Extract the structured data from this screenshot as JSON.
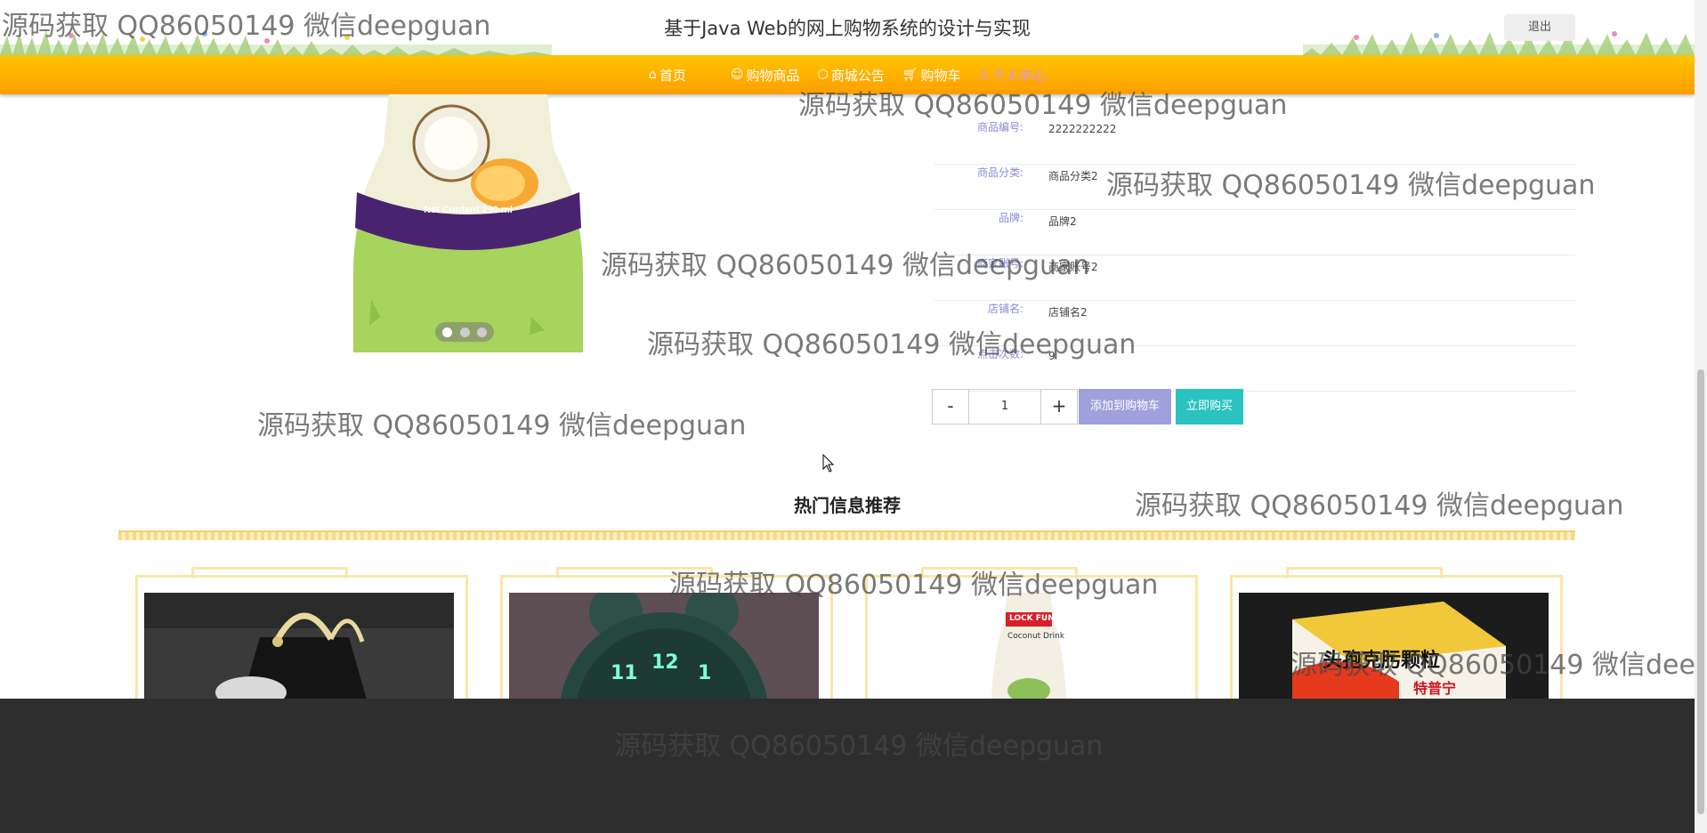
{
  "header": {
    "site_title": "基于Java Web的网上购物系统的设计与实现",
    "logout_label": "退出"
  },
  "nav": {
    "items": [
      {
        "label": "首页",
        "icon": "home-icon",
        "active": false
      },
      {
        "label": "购物商品",
        "icon": "smile-icon",
        "active": false
      },
      {
        "label": "商城公告",
        "icon": "box-icon",
        "active": false
      },
      {
        "label": "购物车",
        "icon": "cart-icon",
        "active": false
      },
      {
        "label": "个人中心",
        "icon": "user-icon",
        "active": true
      }
    ]
  },
  "product": {
    "image_caption": "Net Content 290 ml",
    "fields": [
      {
        "label": "商品编号:",
        "value": "2222222222"
      },
      {
        "label": "商品分类:",
        "value": "商品分类2"
      },
      {
        "label": "品牌:",
        "value": "品牌2"
      },
      {
        "label": "商家账号:",
        "value": "商家账号2"
      },
      {
        "label": "店铺名:",
        "value": "店铺名2"
      },
      {
        "label": "点击次数:",
        "value": "9"
      }
    ],
    "quantity": {
      "minus": "-",
      "value": "1",
      "plus": "+"
    },
    "add_to_cart_label": "添加到购物车",
    "buy_now_label": "立即购买"
  },
  "recommend": {
    "title": "热门信息推荐",
    "cards": [
      {
        "image": "black-handbag"
      },
      {
        "image": "green-alarm-clock",
        "clock_digits": [
          "11",
          "12",
          "1"
        ]
      },
      {
        "image": "coconut-drink-bottle",
        "brand": "LOCK FUN",
        "product": "Coconut Drink"
      },
      {
        "image": "medicine-box",
        "product": "头孢克肟颗粒",
        "sub": "特普宁"
      }
    ]
  },
  "watermark_text": "源码获取 QQ86050149 微信deepguan",
  "colors": {
    "nav_gradient_top": "#ffc400",
    "nav_gradient_bottom": "#ff9e00",
    "nav_active": "#d58dff",
    "label_color": "#8a8ad8",
    "add_to_cart": "#a0a0dc",
    "buy_now": "#2ac3c0",
    "card_border": "#fae6a8",
    "footer": "#2e2e2e"
  }
}
